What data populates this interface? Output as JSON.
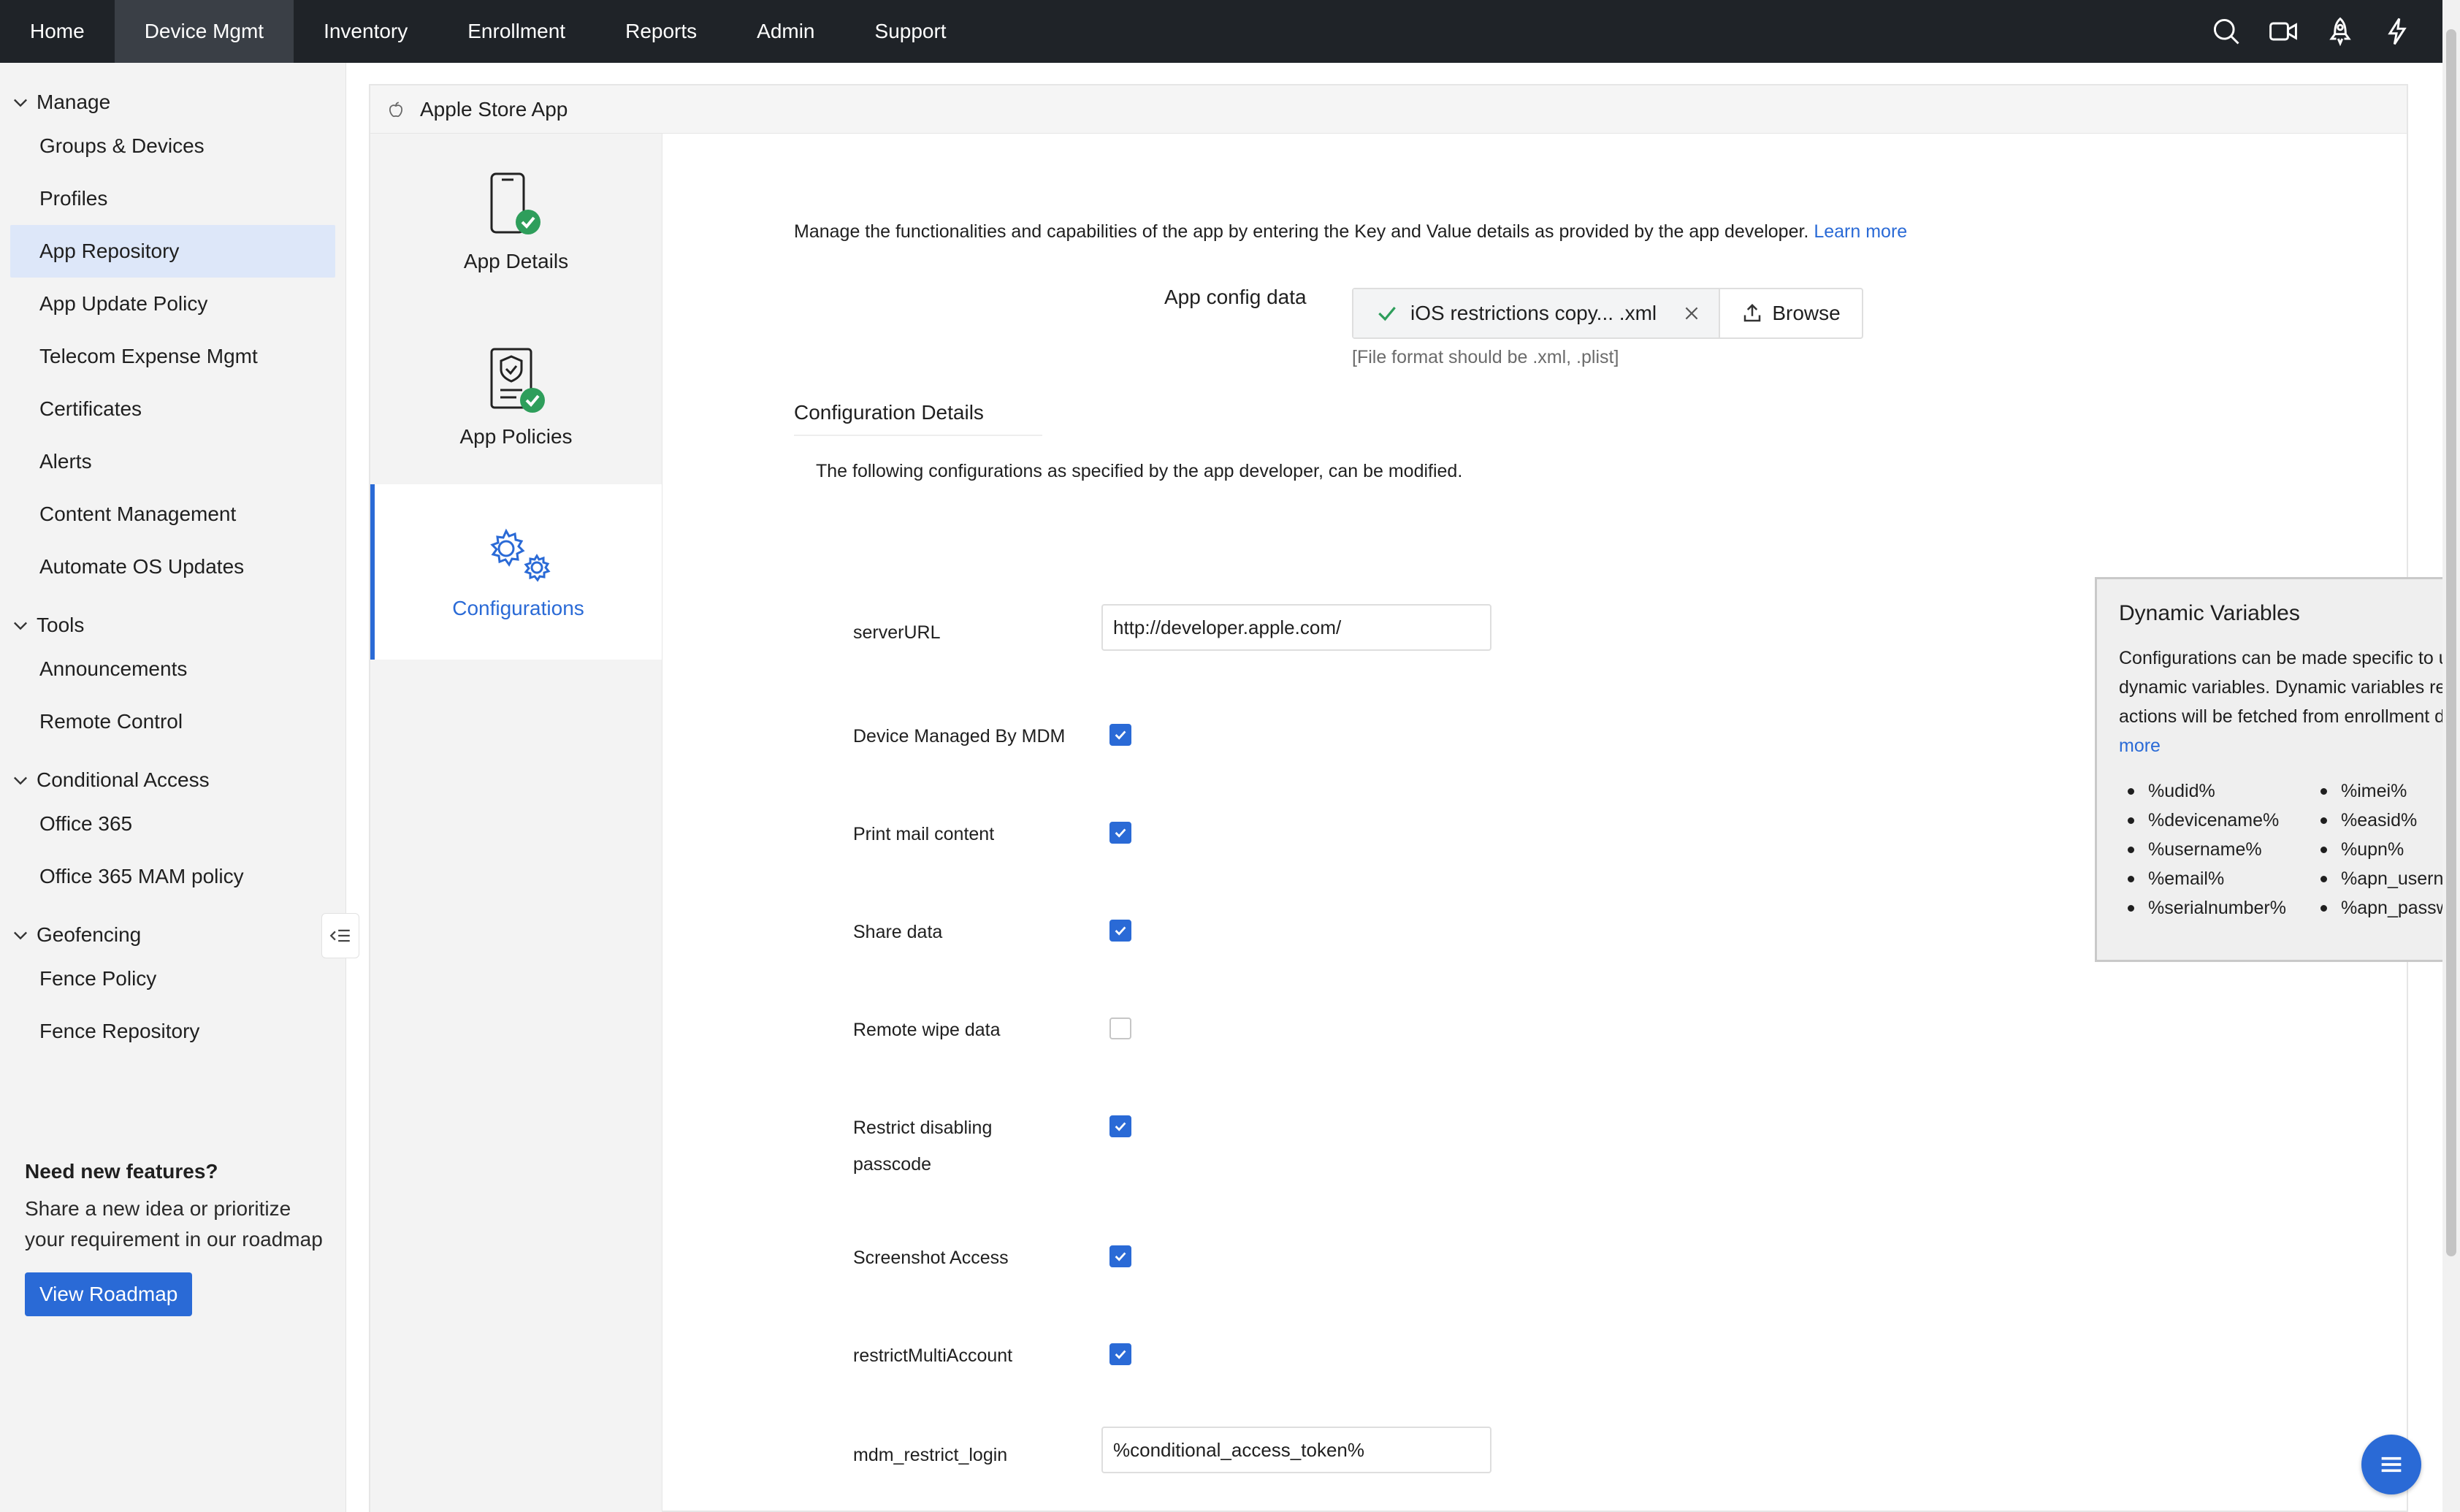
{
  "nav": {
    "tabs": [
      "Home",
      "Device Mgmt",
      "Inventory",
      "Enrollment",
      "Reports",
      "Admin",
      "Support"
    ],
    "active": "Device Mgmt",
    "tool_icons": [
      "search-icon",
      "video-icon",
      "rocket-icon",
      "lightning-icon"
    ]
  },
  "sidebar": {
    "sections": [
      {
        "title": "Manage",
        "items": [
          "Groups & Devices",
          "Profiles",
          "App Repository",
          "App Update Policy",
          "Telecom Expense Mgmt",
          "Certificates",
          "Alerts",
          "Content Management",
          "Automate OS Updates"
        ]
      },
      {
        "title": "Tools",
        "items": [
          "Announcements",
          "Remote Control"
        ]
      },
      {
        "title": "Conditional Access",
        "items": [
          "Office 365",
          "Office 365 MAM policy"
        ]
      },
      {
        "title": "Geofencing",
        "items": [
          "Fence Policy",
          "Fence Repository"
        ]
      }
    ],
    "active_item": "App Repository",
    "promo": {
      "heading": "Need new features?",
      "text": "Share a new idea or prioritize your requirement in our roadmap",
      "button": "View Roadmap"
    }
  },
  "panel": {
    "title": "Apple Store App",
    "steps": [
      "App Details",
      "App Policies",
      "Configurations"
    ],
    "active_step": "Configurations"
  },
  "config": {
    "intro": "Manage the functionalities and capabilities of the app by entering the Key and Value details as provided by the app developer.",
    "intro_link": "Learn more",
    "app_config_label": "App config data",
    "file_name": "iOS  restrictions copy... .xml",
    "browse_label": "Browse",
    "file_hint": "[File format should be .xml, .plist]",
    "section_title": "Configuration Details",
    "sub_intro": "The following configurations as specified by the app developer, can be modified.",
    "rows": [
      {
        "label": "serverURL",
        "type": "text",
        "value": "http://developer.apple.com/"
      },
      {
        "label": "Device Managed By MDM",
        "type": "checkbox",
        "checked": true
      },
      {
        "label": "Print mail content",
        "type": "checkbox",
        "checked": true
      },
      {
        "label": "Share data",
        "type": "checkbox",
        "checked": true
      },
      {
        "label": "Remote wipe data",
        "type": "checkbox",
        "checked": false
      },
      {
        "label": "Restrict disabling passcode",
        "type": "checkbox",
        "checked": true
      },
      {
        "label": "Screenshot Access",
        "type": "checkbox",
        "checked": true
      },
      {
        "label": "restrictMultiAccount",
        "type": "checkbox",
        "checked": true
      },
      {
        "label": "mdm_restrict_login",
        "type": "text",
        "value": "%conditional_access_token%"
      }
    ]
  },
  "dynamic_vars": {
    "title": "Dynamic Variables",
    "text": "Configurations can be made specific to users through dynamic variables. Dynamic variables required for the actions will be fetched from enrollment details.",
    "link": "Learn more",
    "col1": [
      "%udid%",
      "%devicename%",
      "%username%",
      "%email%",
      "%serialnumber%"
    ],
    "col2": [
      "%imei%",
      "%easid%",
      "%upn%",
      "%apn_username%",
      "%apn_password%"
    ]
  },
  "colors": {
    "accent": "#2a6ad6",
    "topbar": "#1f2328",
    "success": "#2e9e5b"
  }
}
